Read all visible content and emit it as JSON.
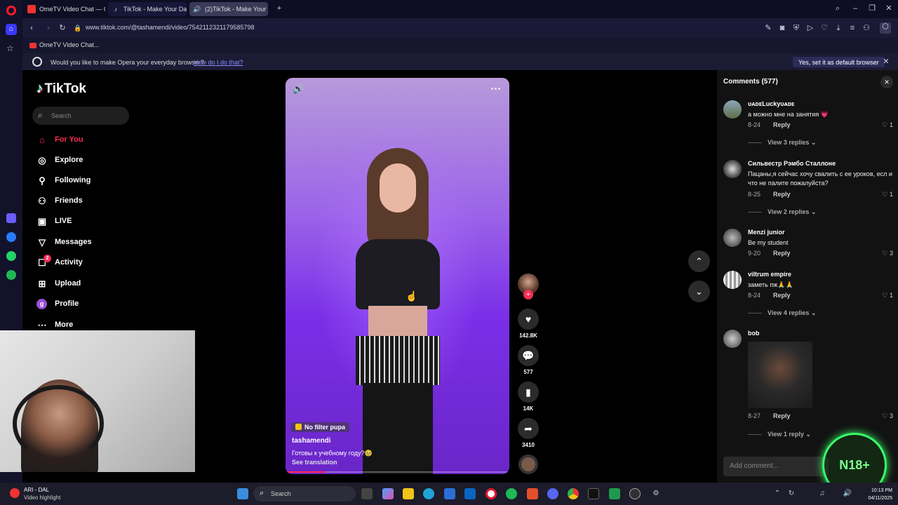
{
  "browser": {
    "tabs": [
      {
        "label": "OmeTV Video Chat — Or"
      },
      {
        "label": "TikTok - Make Your Day"
      },
      {
        "label": "(2)TikTok - Make Your"
      }
    ],
    "url": "www.tiktok.com/@tashamendi/video/7542112321179585798",
    "bookmark": "OmeTV Video Chat...",
    "infobar": {
      "question": "Would you like to make Opera your everyday browser?",
      "link": "How do I do that?",
      "button": "Yes, set it as default browser"
    }
  },
  "tiktok": {
    "logo": "TikTok",
    "search_placeholder": "Search",
    "nav": [
      {
        "label": "For You",
        "icon": "home-icon"
      },
      {
        "label": "Explore",
        "icon": "compass-icon"
      },
      {
        "label": "Following",
        "icon": "following-icon"
      },
      {
        "label": "Friends",
        "icon": "friends-icon"
      },
      {
        "label": "LIVE",
        "icon": "live-icon"
      },
      {
        "label": "Messages",
        "icon": "send-icon"
      },
      {
        "label": "Activity",
        "icon": "activity-icon",
        "badge": "2"
      },
      {
        "label": "Upload",
        "icon": "upload-icon"
      },
      {
        "label": "Profile",
        "icon": "profile-icon",
        "avatar_letter": "g"
      },
      {
        "label": "More",
        "icon": "more-icon"
      }
    ],
    "video": {
      "effect_label": "No filter pupa",
      "username": "tashamendi",
      "caption": "Готовы к учебному году?🥹",
      "translation": "See translation"
    },
    "actions": {
      "likes": "142.8K",
      "comments": "577",
      "saves": "14K",
      "shares": "3410"
    }
  },
  "comments_panel": {
    "title": "Comments (577)",
    "items": [
      {
        "user": "ᴜᴀᴅᴇLuckyᴜᴀᴅᴇ",
        "text": "а можно мне на занятия 💗",
        "date": "8-24",
        "reply": "Reply",
        "likes": "1",
        "view": "View 3 replies"
      },
      {
        "user": "Сильвестр Рэмбо Сталлоне",
        "text": "Пацаны,я сейчас хочу свалить с ее уроков, есл и что не палите пожалуйста?",
        "date": "8-25",
        "reply": "Reply",
        "likes": "1",
        "view": "View 2 replies"
      },
      {
        "user": "Menzi junior",
        "text": "Be my student",
        "date": "9-20",
        "reply": "Reply",
        "likes": "3",
        "view": ""
      },
      {
        "user": "viltrum empire",
        "text": "заметь пж🙏🙏",
        "date": "8-24",
        "reply": "Reply",
        "likes": "1",
        "view": "View 4 replies"
      },
      {
        "user": "bob",
        "text": "",
        "date": "8-27",
        "reply": "Reply",
        "likes": "3",
        "view": "View 1 reply"
      }
    ],
    "add_comment_placeholder": "Add comment...",
    "watermark": "N18+"
  },
  "taskbar": {
    "weather_title": "ARI - DAL",
    "weather_sub": "Video highlight",
    "search": "Search",
    "time": "10:13 PM",
    "date": "04/11/2025"
  }
}
